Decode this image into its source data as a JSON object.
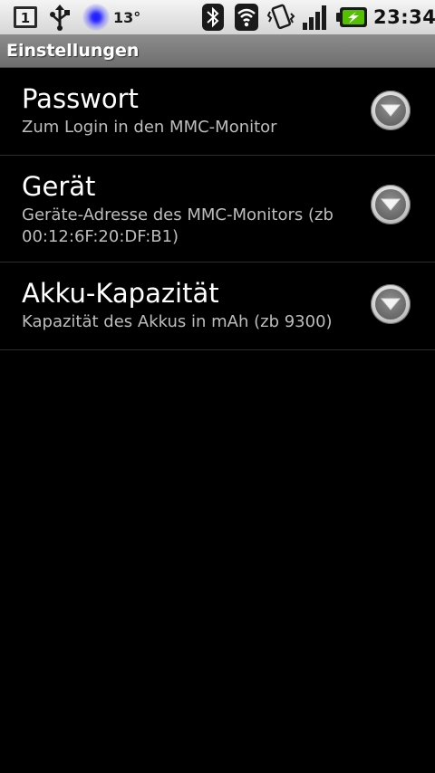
{
  "status_bar": {
    "sim_slot": "1",
    "temperature": "13°",
    "clock": "23:34",
    "icons": [
      "sim-card-icon",
      "usb-icon",
      "notification-light-icon",
      "bluetooth-icon",
      "wifi-icon",
      "vibrate-icon",
      "signal-icon",
      "battery-charging-icon"
    ],
    "battery_color": "#55c000"
  },
  "title_bar": {
    "title": "Einstellungen"
  },
  "preferences": [
    {
      "title": "Passwort",
      "summary": "Zum Login in den MMC-Monitor",
      "icon": "dropdown-arrow-icon"
    },
    {
      "title": "Gerät",
      "summary": "Geräte-Adresse des MMC-Monitors (zb 00:12:6F:20:DF:B1)",
      "icon": "dropdown-arrow-icon"
    },
    {
      "title": "Akku-Kapazität",
      "summary": "Kapazität des Akkus in mAh (zb 9300)",
      "icon": "dropdown-arrow-icon"
    }
  ]
}
